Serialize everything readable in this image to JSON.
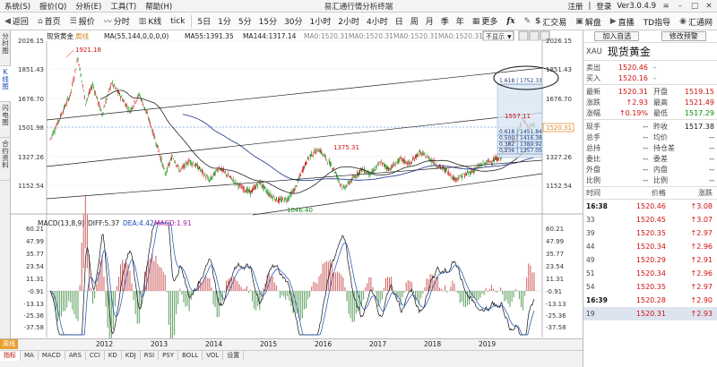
{
  "window": {
    "title": "易汇通行情分析终端",
    "menus": [
      "系统(S)",
      "报价(Q)",
      "分析(E)",
      "工具(T)",
      "帮助(H)"
    ],
    "login": "注册",
    "register": "登录",
    "version": "Ver3.0.4.9"
  },
  "toolbar": {
    "back": "返回",
    "home": "首页",
    "quote": "报价",
    "time": "分时",
    "kline": "K线",
    "tick": "tick",
    "periods": [
      "5日",
      "1分",
      "5分",
      "15分",
      "30分",
      "1小时",
      "2小时",
      "4小时",
      "日",
      "周",
      "月",
      "季",
      "年"
    ],
    "more": "更多",
    "fx": "fx",
    "fx_exchange": "汇交易",
    "interpret": "解盘",
    "live": "直播",
    "td_guide": "TD指导",
    "huitong": "汇通网"
  },
  "left_tabs": [
    "分时图",
    "K线图",
    "闪电图",
    "合约资料"
  ],
  "chart": {
    "instrument": "现货黄金",
    "period": "周线",
    "ma_label": "MA(55,144,0,0,0,0)",
    "ma55": "MA55:1391.35",
    "ma144": "MA144:1317.14",
    "ma0a": "MA0:1520.31",
    "ma0b": "MA0:1520.31",
    "ma0c": "MA0:1520.31",
    "ma0d": "MA0:1520.31",
    "not_shown": "不显示",
    "price_axis": [
      "2026.15",
      "1851.43",
      "1676.70",
      "1501.98",
      "1327.26",
      "1152.54"
    ],
    "price_axis_right": [
      "2026.15",
      "1851.43",
      "1676.70",
      "1501.98",
      "1327.26",
      "1152.54"
    ],
    "current_price_tag": "1520.31",
    "annotations": {
      "high_2011": "1921.18",
      "high_2016": "1375.31",
      "low_2015": "1046.40",
      "recent_high": "1557.11"
    },
    "fib": [
      "1.618 | 1752.33",
      "0.618 | 1451.84",
      "0.500 | 1416.38",
      "0.382 | 1380.92",
      "0.236 | 1357.05"
    ],
    "macd_label": "MACD(13,8,9)",
    "diff": "DIFF:5.37",
    "dea": "DEA:4.42",
    "macd": "MACD:1.91",
    "macd_axis": [
      "60.21",
      "47.99",
      "35.77",
      "23.54",
      "11.31",
      "-0.91",
      "-13.13",
      "-25.36",
      "-37.58"
    ],
    "years": [
      "2012",
      "2013",
      "2014",
      "2015",
      "2016",
      "2017",
      "2018",
      "2019"
    ]
  },
  "bottom": {
    "tabs": [
      "指标",
      "MA",
      "MACD",
      "ARS",
      "CCI",
      "KD",
      "KDJ",
      "RSI",
      "PSY",
      "BOLL",
      "VOL",
      "设置"
    ],
    "corner": "周线",
    "sub_corner": "指标"
  },
  "right_panel": {
    "add_watch": "加入自选",
    "alert": "修改预警",
    "code": "XAU",
    "name": "现货黄金",
    "sell_label": "卖出",
    "sell_value": "1520.46",
    "buy_label": "买入",
    "buy_value": "1520.16",
    "rows": [
      {
        "l": "最新",
        "v": "1520.31",
        "l2": "开盘",
        "v2": "1519.15"
      },
      {
        "l": "涨跌",
        "v": "2.93",
        "l2": "最高",
        "v2": "1521.49"
      },
      {
        "l": "涨幅",
        "v": "0.19%",
        "l2": "最低",
        "v2": "1517.29"
      }
    ],
    "prev_label": "现手",
    "prev_v": "--",
    "prevclose_label": "昨收",
    "prevclose_v": "1517.38",
    "vol_rows": [
      {
        "l": "总手",
        "v": "--",
        "l2": "均价",
        "v2": "--"
      },
      {
        "l": "总持",
        "v": "--",
        "l2": "持仓差",
        "v2": "--"
      },
      {
        "l": "委比",
        "v": "--",
        "l2": "委差",
        "v2": "--"
      },
      {
        "l": "外盘",
        "v": "--",
        "l2": "内盘",
        "v2": "--"
      },
      {
        "l": "比例",
        "v": "--",
        "l2": "比例",
        "v2": "--"
      }
    ],
    "ticks_head": [
      "时间",
      "价格",
      "涨跌"
    ],
    "ticks": [
      {
        "t": "16:38",
        "p": "1520.46",
        "c": "3.08",
        "bold": true
      },
      {
        "t": "33",
        "p": "1520.45",
        "c": "3.07"
      },
      {
        "t": "39",
        "p": "1520.35",
        "p_dummy": "",
        "c": "2.97"
      },
      {
        "t": "44",
        "p": "1520.34",
        "c": "2.96"
      },
      {
        "t": "49",
        "p": "1520.29",
        "c": "2.91"
      },
      {
        "t": "51",
        "p": "1520.34",
        "c": "2.96"
      },
      {
        "t": "54",
        "p": "1520.35",
        "c": "2.97"
      },
      {
        "t": "16:39",
        "p": "1520.28",
        "c": "2.90",
        "bold": true
      },
      {
        "t": "19",
        "p": "1520.31",
        "c": "2.93",
        "hl": true
      }
    ]
  },
  "colors": {
    "up": "#d01010",
    "down": "#0a8a0a",
    "accent": "#1a4db3"
  }
}
